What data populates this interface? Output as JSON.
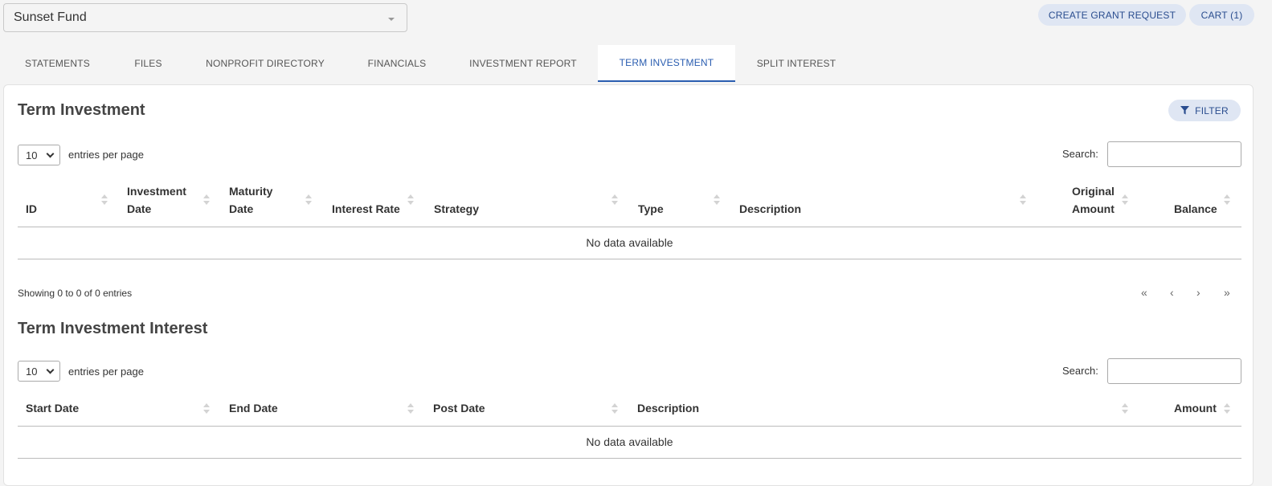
{
  "header": {
    "fund_name": "Sunset Fund",
    "create_grant_label": "CREATE GRANT REQUEST",
    "cart_label": "CART (1)"
  },
  "tabs": [
    {
      "label": "STATEMENTS"
    },
    {
      "label": "FILES"
    },
    {
      "label": "NONPROFIT DIRECTORY"
    },
    {
      "label": "FINANCIALS"
    },
    {
      "label": "INVESTMENT REPORT"
    },
    {
      "label": "TERM INVESTMENT",
      "active": true
    },
    {
      "label": "SPLIT INTEREST"
    }
  ],
  "term_investment": {
    "title": "Term Investment",
    "filter_label": "FILTER",
    "entries_value": "10",
    "entries_label": "entries per page",
    "search_label": "Search:",
    "search_value": "",
    "columns": [
      {
        "line1": "",
        "line2": "ID"
      },
      {
        "line1": "Investment",
        "line2": "Date"
      },
      {
        "line1": "Maturity",
        "line2": "Date"
      },
      {
        "line1": "",
        "line2": "Interest Rate"
      },
      {
        "line1": "",
        "line2": "Strategy"
      },
      {
        "line1": "",
        "line2": "Type"
      },
      {
        "line1": "",
        "line2": "Description"
      },
      {
        "line1": "Original",
        "line2": "Amount"
      },
      {
        "line1": "",
        "line2": "Balance"
      }
    ],
    "empty_text": "No data available",
    "showing_text": "Showing 0 to 0 of 0 entries",
    "pager": {
      "first": "«",
      "prev": "‹",
      "next": "›",
      "last": "»"
    }
  },
  "term_investment_interest": {
    "title": "Term Investment Interest",
    "entries_value": "10",
    "entries_label": "entries per page",
    "search_label": "Search:",
    "search_value": "",
    "columns": [
      {
        "label": "Start Date"
      },
      {
        "label": "End Date"
      },
      {
        "label": "Post Date"
      },
      {
        "label": "Description"
      },
      {
        "label": "Amount"
      }
    ],
    "empty_text": "No data available"
  },
  "colors": {
    "accent": "#2a5db0",
    "pill_bg": "#dfe6f3",
    "page_bg": "#f4f4f4"
  }
}
